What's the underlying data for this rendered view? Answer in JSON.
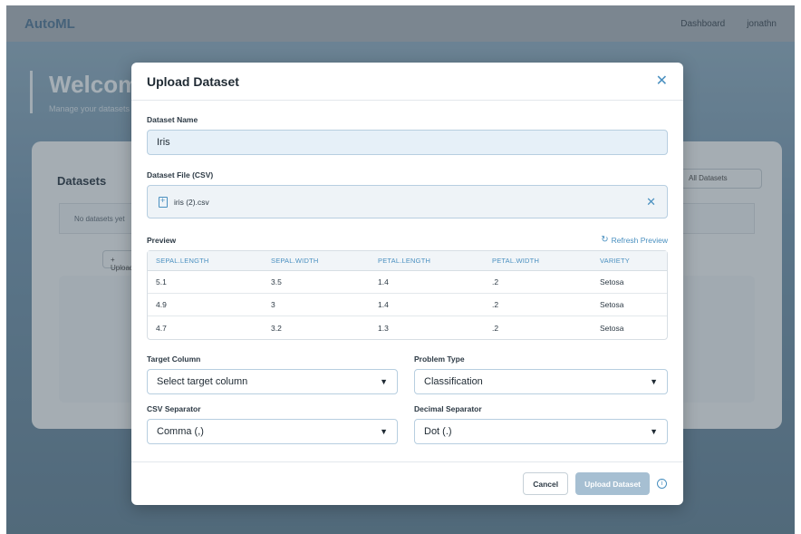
{
  "app": {
    "brand": "AutoML",
    "nav": [
      "Dashboard",
      "jonathn"
    ],
    "hero_title": "Welcome",
    "hero_sub": "Manage your datasets",
    "panel_title": "Datasets",
    "panel_select": "All Datasets",
    "panel_box_text": "No datasets yet",
    "panel_btn": "+ Upload"
  },
  "modal": {
    "title": "Upload Dataset",
    "dataset_name_label": "Dataset Name",
    "dataset_name_value": "Iris",
    "dataset_file_label": "Dataset File (CSV)",
    "file_name": "iris (2).csv",
    "preview_label": "Preview",
    "refresh_label": "Refresh Preview",
    "table": {
      "headers": [
        "SEPAL.LENGTH",
        "SEPAL.WIDTH",
        "PETAL.LENGTH",
        "PETAL.WIDTH",
        "VARIETY"
      ],
      "rows": [
        [
          "5.1",
          "3.5",
          "1.4",
          ".2",
          "Setosa"
        ],
        [
          "4.9",
          "3",
          "1.4",
          ".2",
          "Setosa"
        ],
        [
          "4.7",
          "3.2",
          "1.3",
          ".2",
          "Setosa"
        ]
      ]
    },
    "target_label": "Target Column",
    "target_value": "Select target column",
    "problem_label": "Problem Type",
    "problem_value": "Classification",
    "csv_sep_label": "CSV Separator",
    "csv_sep_value": "Comma (,)",
    "dec_sep_label": "Decimal Separator",
    "dec_sep_value": "Dot (.)",
    "cancel_label": "Cancel",
    "upload_label": "Upload Dataset",
    "info_glyph": "i"
  }
}
